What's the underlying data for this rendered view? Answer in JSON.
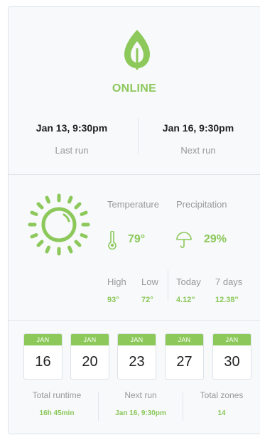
{
  "status": {
    "text": "ONLINE",
    "last_run": {
      "date": "Jan 13, 9:30pm",
      "label": "Last run"
    },
    "next_run": {
      "date": "Jan 16, 9:30pm",
      "label": "Next run"
    }
  },
  "weather": {
    "temperature": {
      "label": "Temperature",
      "value": "79°"
    },
    "precipitation": {
      "label": "Precipitation",
      "value": "29%"
    },
    "high": {
      "label": "High",
      "value": "93°"
    },
    "low": {
      "label": "Low",
      "value": "72°"
    },
    "today": {
      "label": "Today",
      "value": "4.12\""
    },
    "seven_days": {
      "label": "7 days",
      "value": "12.38\""
    }
  },
  "schedule": {
    "days": [
      {
        "month": "JAN",
        "day": "16"
      },
      {
        "month": "JAN",
        "day": "20"
      },
      {
        "month": "JAN",
        "day": "23"
      },
      {
        "month": "JAN",
        "day": "27"
      },
      {
        "month": "JAN",
        "day": "30"
      }
    ],
    "total_runtime": {
      "label": "Total runtime",
      "value": "16h 45min"
    },
    "next_run": {
      "label": "Next run",
      "value": "Jan 16, 9:30pm"
    },
    "total_zones": {
      "label": "Total zones",
      "value": "14"
    }
  },
  "colors": {
    "accent": "#8cc85a",
    "muted": "#999999",
    "border": "#e2e6ea"
  },
  "icons": [
    "leaf-icon",
    "sun-icon",
    "thermometer-icon",
    "umbrella-icon"
  ]
}
